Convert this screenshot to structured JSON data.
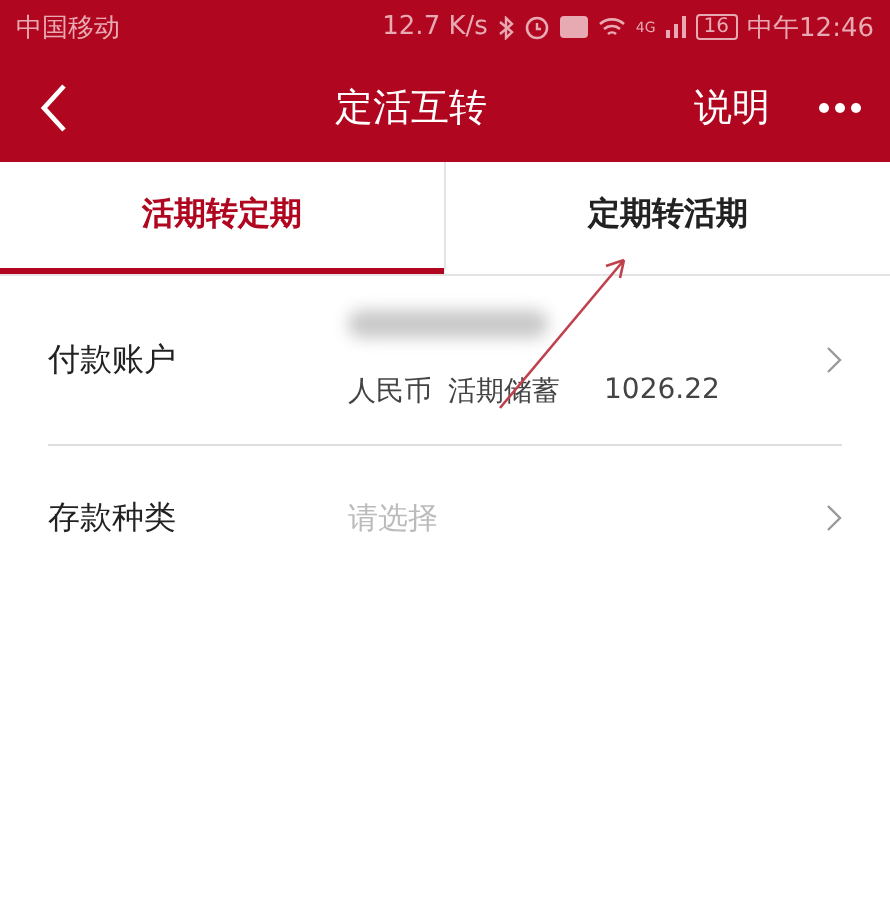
{
  "status_bar": {
    "carrier": "中国移动",
    "speed": "12.7 K/s",
    "network": "4G",
    "battery": "16",
    "time": "中午12:46"
  },
  "nav": {
    "title": "定活互转",
    "action": "说明"
  },
  "tabs": [
    {
      "label": "活期转定期",
      "selected": true
    },
    {
      "label": "定期转活期",
      "selected": false
    }
  ],
  "rows": [
    {
      "kind": "account",
      "label": "付款账户",
      "currency": "人民币",
      "account_type": "活期储蓄",
      "balance": "1026.22"
    },
    {
      "kind": "select",
      "label": "存款种类",
      "placeholder": "请选择"
    }
  ]
}
